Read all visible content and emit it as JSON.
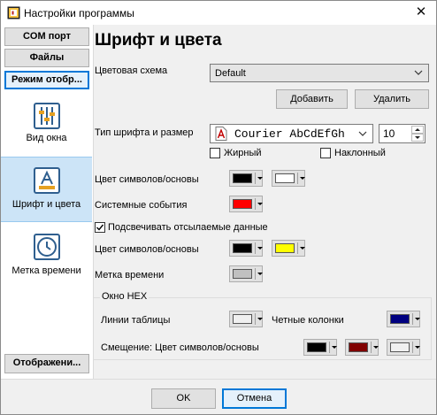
{
  "window": {
    "title": "Настройки программы"
  },
  "sidebar": {
    "com_port": "COM порт",
    "files": "Файлы",
    "display_mode": "Режим отобр...",
    "window_view": "Вид окна",
    "font_colors": "Шрифт и цвета",
    "time_stamp": "Метка времени",
    "display": "Отображени..."
  },
  "main": {
    "heading": "Шрифт и цвета",
    "color_scheme_label": "Цветовая схема",
    "color_scheme_value": "Default",
    "add_button": "Добавить",
    "delete_button": "Удалить",
    "font_label": "Тип шрифта и размер",
    "font_value": "Courier AbCdEfGh",
    "font_size": "10",
    "bold_label": "Жирный",
    "bold_checked": false,
    "italic_label": "Наклонный",
    "italic_checked": false,
    "symbols_bg_label": "Цвет символов/основы",
    "symbols_fg_color": "#000000",
    "symbols_bg_color": "#ffffff",
    "system_events_label": "Системные события",
    "system_events_color": "#ff0000",
    "highlight_label": "Подсвечивать отсылаемые данные",
    "highlight_checked": true,
    "sent_colors_label": "Цвет символов/основы",
    "sent_fg_color": "#000000",
    "sent_bg_color": "#ffff00",
    "timestamp_label": "Метка времени",
    "timestamp_color": "#c0c0c0",
    "hex_group": {
      "title": "Окно HEX",
      "grid_lines_label": "Линии таблицы",
      "grid_lines_color": "#f0f0f0",
      "even_columns_label": "Четные колонки",
      "even_columns_color": "#000080",
      "offset_label": "Смещение: Цвет символов/основы",
      "offset_fg_color": "#000000",
      "offset_mid_color": "#800000",
      "offset_bg_color": "#f0f0f0"
    }
  },
  "footer": {
    "ok": "OK",
    "cancel": "Отмена"
  }
}
